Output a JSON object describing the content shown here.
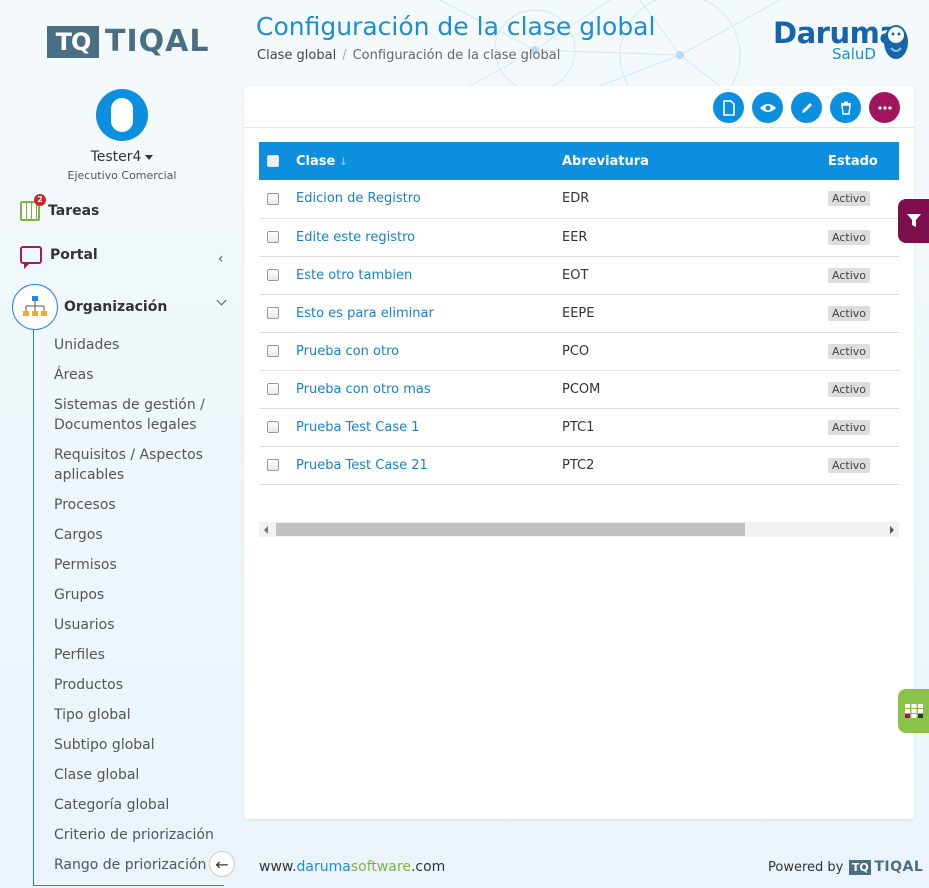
{
  "brand": {
    "logo_box": "TQ",
    "logo_text": "TIQAL",
    "daruma": "Daruma",
    "salud": "SaluD"
  },
  "page": {
    "title": "Configuración de la clase global",
    "breadcrumb": [
      "Clase global",
      "Configuración de la clase global"
    ]
  },
  "user": {
    "name": "Tester4",
    "role": "Ejecutivo Comercial"
  },
  "nav": {
    "tareas": {
      "label": "Tareas",
      "badge": "2"
    },
    "portal": {
      "label": "Portal"
    },
    "organizacion": {
      "label": "Organización"
    }
  },
  "submenu": [
    "Unidades",
    "Áreas",
    "Sistemas de gestión / Documentos legales",
    "Requisitos / Aspectos aplicables",
    "Procesos",
    "Cargos",
    "Permisos",
    "Grupos",
    "Usuarios",
    "Perfiles",
    "Productos",
    "Tipo global",
    "Subtipo global",
    "Clase global",
    "Categoría global",
    "Criterio de priorización",
    "Rango de priorización"
  ],
  "table": {
    "headers": {
      "clase": "Clase",
      "abreviatura": "Abreviatura",
      "estado": "Estado"
    },
    "rows": [
      {
        "clase": "Edicion de Registro",
        "abreviatura": "EDR",
        "estado": "Activo"
      },
      {
        "clase": "Edite este registro",
        "abreviatura": "EER",
        "estado": "Activo"
      },
      {
        "clase": "Este otro tambien",
        "abreviatura": "EOT",
        "estado": "Activo"
      },
      {
        "clase": "Esto es para eliminar",
        "abreviatura": "EEPE",
        "estado": "Activo"
      },
      {
        "clase": "Prueba con otro",
        "abreviatura": "PCO",
        "estado": "Activo"
      },
      {
        "clase": "Prueba con otro mas",
        "abreviatura": "PCOM",
        "estado": "Activo"
      },
      {
        "clase": "Prueba Test Case 1",
        "abreviatura": "PTC1",
        "estado": "Activo"
      },
      {
        "clase": "Prueba Test Case 21",
        "abreviatura": "PTC2",
        "estado": "Activo"
      }
    ]
  },
  "toolbar_icons": [
    "new-document-icon",
    "view-eye-icon",
    "edit-pencil-icon",
    "delete-trash-icon",
    "more-options-icon"
  ],
  "footer": {
    "site_prefix": "www.",
    "site_a": "daruma",
    "site_b": "software",
    "site_suffix": ".com",
    "powered": "Powered by",
    "logo_box": "TQ",
    "logo_text": "TIQAL"
  },
  "colors": {
    "primary": "#0d8fe0",
    "accent": "#a0155c",
    "green": "#8bc34a",
    "logo": "#4a6e82"
  }
}
